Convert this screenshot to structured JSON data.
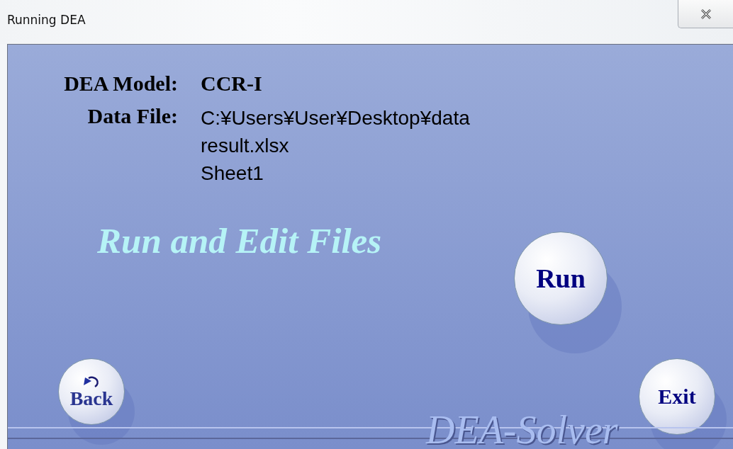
{
  "window": {
    "title": "Running DEA"
  },
  "fields": [
    {
      "label": "DEA Model:",
      "lines": [
        "CCR-I"
      ],
      "kind": "model"
    },
    {
      "label": "Data File:",
      "lines": [
        "C:¥Users¥User¥Desktop¥data",
        "result.xlsx",
        "Sheet1"
      ],
      "kind": "file"
    }
  ],
  "heading": "Run and Edit Files",
  "buttons": [
    {
      "label": "Run",
      "kind": "run"
    },
    {
      "label": "Back",
      "kind": "back"
    },
    {
      "label": "Exit",
      "kind": "exit"
    }
  ],
  "logo": "DEA-Solver"
}
